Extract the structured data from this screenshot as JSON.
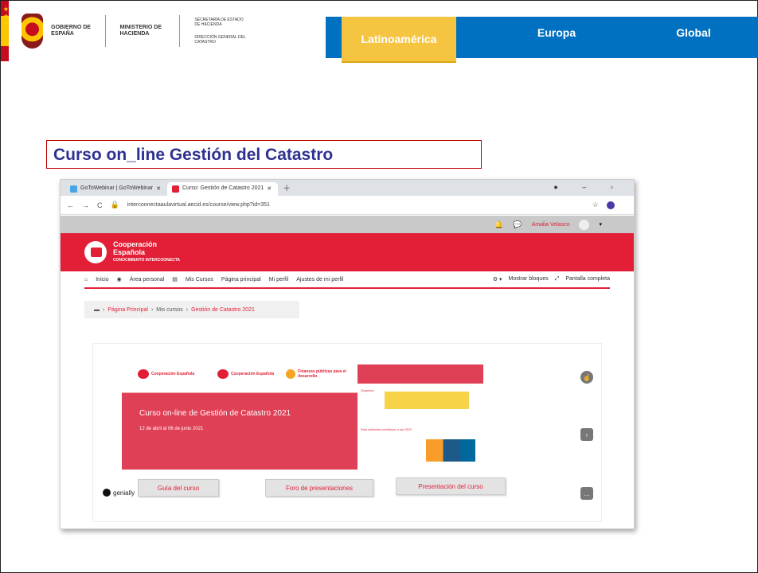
{
  "header": {
    "gov_name": "GOBIERNO DE ESPAÑA",
    "ministry": "MINISTERIO DE HACIENDA",
    "secretaria": "SECRETARÍA DE ESTADO DE HACIENDA",
    "direccion": "DIRECCIÓN GENERAL DEL CATASTRO"
  },
  "tabs": {
    "latam": "Latinoamérica",
    "europa": "Europa",
    "global": "Global"
  },
  "course_title": "Curso on_line Gestión del Catastro",
  "browser": {
    "tab1": "GoToWebinar | GoToWebinar",
    "tab2": "Curso: Gestión de Catastro 2021",
    "url": "intercoonectaaulavirtual.aecid.es/course/view.php?id=351",
    "user_name": "Amalia Velasco"
  },
  "banner": {
    "line1": "Cooperación",
    "line2": "Española",
    "line3": "CONOCIMIENTO INTERCOONECTA"
  },
  "nav": {
    "inicio": "Inicio",
    "area": "Área personal",
    "cursos": "Mis Cursos",
    "principal": "Página principal",
    "perfil": "Mi perfil",
    "ajustes": "Ajustes de mi perfil",
    "mostrar": "Mostrar bloques",
    "pantalla": "Pantalla completa"
  },
  "breadcrumb": {
    "home": "Página Principal",
    "cursos": "Mis cursos",
    "current": "Gestión de Catastro 2021"
  },
  "hero": {
    "logo1": "Cooperación Española",
    "logo2": "Cooperación Española",
    "logo3": "Finanzas públicas para el desarrollo",
    "title": "Curso on-line de Gestión de Catastro 2021",
    "dates": "12 de abril al 06 de junio 2021",
    "organiza": "Organiza",
    "ods": "Esta actividad contribuye a los ODS"
  },
  "buttons": {
    "genially": "genially",
    "guia": "Guía del curso",
    "foro": "Foro de presentaciones",
    "presentacion": "Presentación del curso"
  }
}
